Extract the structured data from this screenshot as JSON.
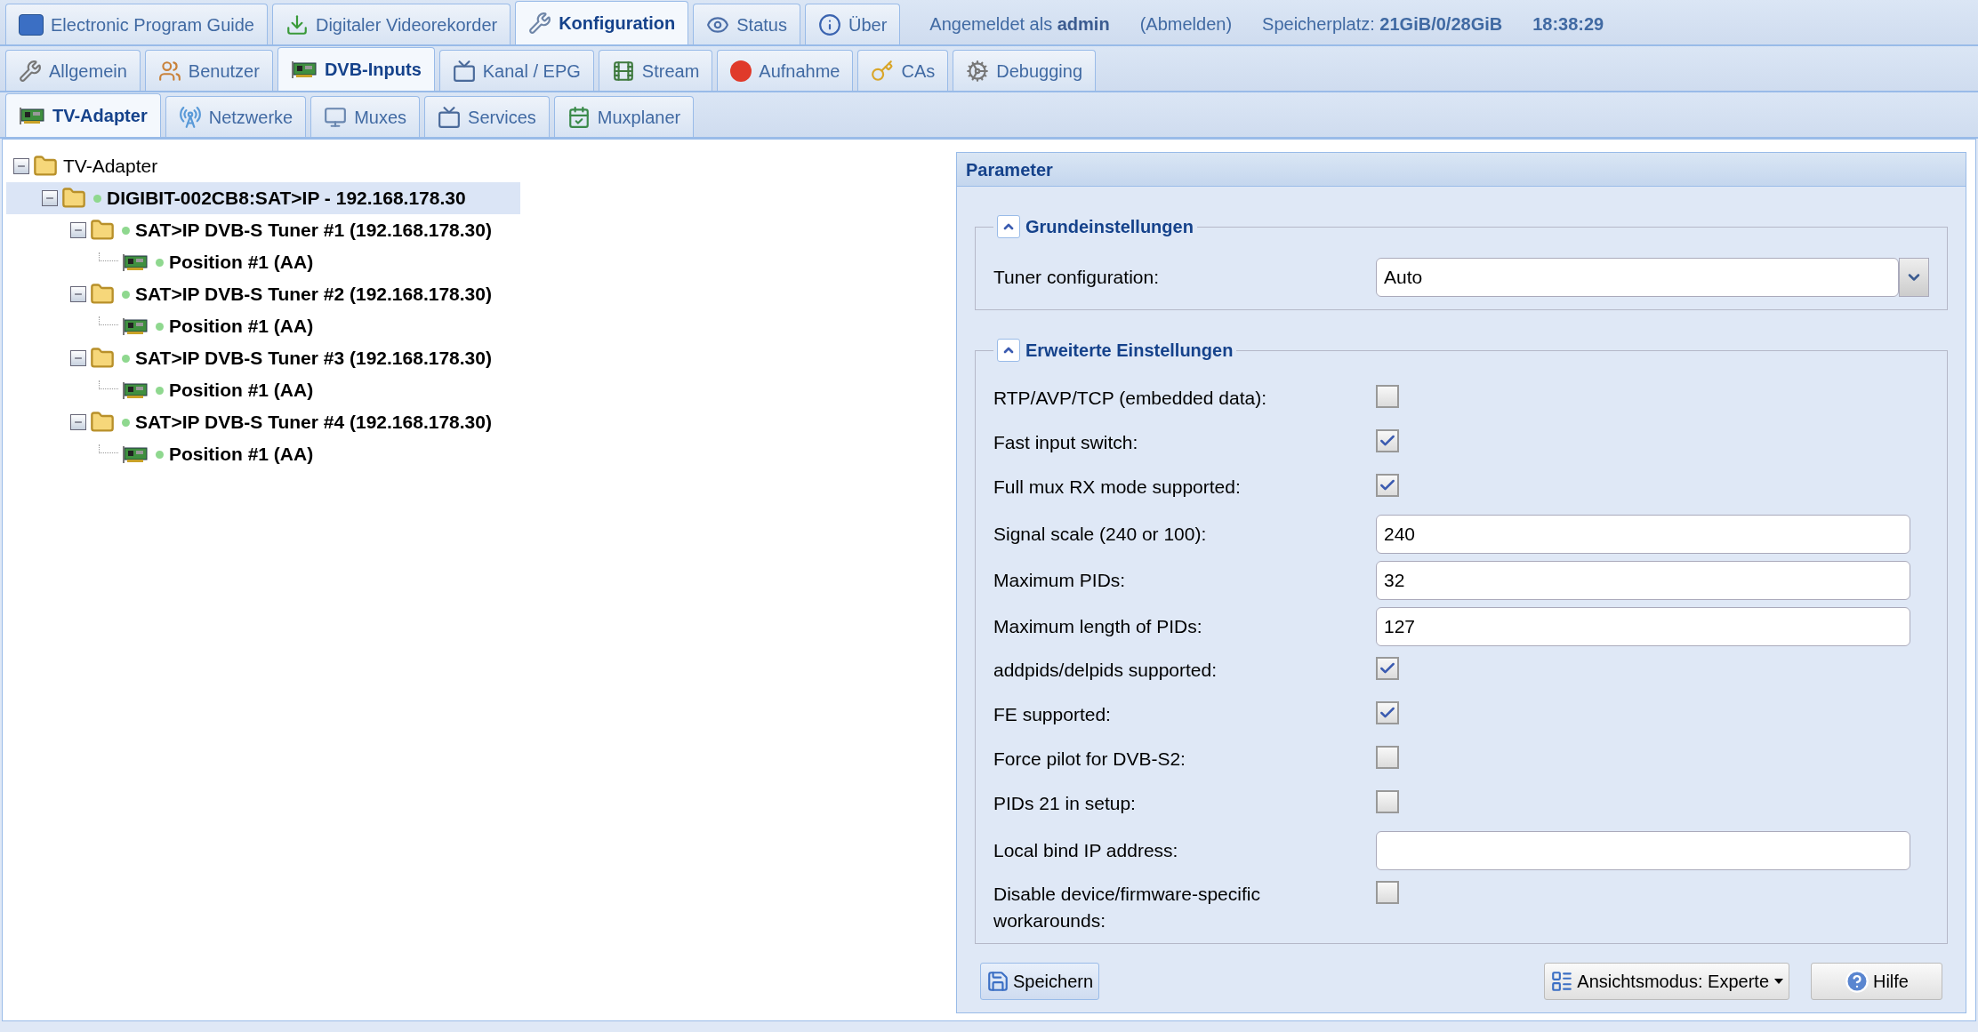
{
  "main_tabs": [
    {
      "label": "Electronic Program Guide",
      "selected": false
    },
    {
      "label": "Digitaler Videorekorder",
      "selected": false
    },
    {
      "label": "Konfiguration",
      "selected": true
    },
    {
      "label": "Status",
      "selected": false
    },
    {
      "label": "Über",
      "selected": false
    }
  ],
  "header": {
    "login": "Angemeldet als **admin**",
    "logout": "(Abmelden)",
    "storage": "Speicherplatz: **21GiB/0/28GiB**",
    "time": "18:38:29"
  },
  "config_tabs": [
    {
      "label": "Allgemein",
      "selected": false
    },
    {
      "label": "Benutzer",
      "selected": false
    },
    {
      "label": "DVB-Inputs",
      "selected": true
    },
    {
      "label": "Kanal / EPG",
      "selected": false
    },
    {
      "label": "Stream",
      "selected": false
    },
    {
      "label": "Aufnahme",
      "selected": false
    },
    {
      "label": "CAs",
      "selected": false
    },
    {
      "label": "Debugging",
      "selected": false
    }
  ],
  "dvb_tabs": [
    {
      "label": "TV-Adapter",
      "selected": true
    },
    {
      "label": "Netzwerke",
      "selected": false
    },
    {
      "label": "Muxes",
      "selected": false
    },
    {
      "label": "Services",
      "selected": false
    },
    {
      "label": "Muxplaner",
      "selected": false
    }
  ],
  "tree": [
    {
      "label": "TV-Adapter",
      "kind": "root",
      "expanded": true,
      "selected": false,
      "children": [
        {
          "label": "DIGIBIT-002CB8:SAT>IP - 192.168.178.30",
          "kind": "folder",
          "expanded": true,
          "selected": true,
          "children": [
            {
              "label": "SAT>IP DVB-S Tuner #1 (192.168.178.30)",
              "kind": "folder",
              "expanded": true,
              "selected": false,
              "children": [
                {
                  "label": "Position #1 (AA)",
                  "kind": "adapter",
                  "selected": false
                }
              ]
            },
            {
              "label": "SAT>IP DVB-S Tuner #2 (192.168.178.30)",
              "kind": "folder",
              "expanded": true,
              "selected": false,
              "children": [
                {
                  "label": "Position #1 (AA)",
                  "kind": "adapter",
                  "selected": false
                }
              ]
            },
            {
              "label": "SAT>IP DVB-S Tuner #3 (192.168.178.30)",
              "kind": "folder",
              "expanded": true,
              "selected": false,
              "children": [
                {
                  "label": "Position #1 (AA)",
                  "kind": "adapter",
                  "selected": false
                }
              ]
            },
            {
              "label": "SAT>IP DVB-S Tuner #4 (192.168.178.30)",
              "kind": "folder",
              "expanded": true,
              "selected": false,
              "children": [
                {
                  "label": "Position #1 (AA)",
                  "kind": "adapter",
                  "selected": false
                }
              ]
            }
          ]
        }
      ]
    }
  ],
  "parameter_panel": {
    "title": "Parameter",
    "sections": [
      {
        "title": "Grundeinstellungen",
        "expanded": true,
        "fields": [
          {
            "kind": "select",
            "label": "Tuner configuration:",
            "value": "Auto"
          }
        ]
      },
      {
        "title": "Erweiterte Einstellungen",
        "expanded": true,
        "fields": [
          {
            "kind": "checkbox",
            "label": "RTP/AVP/TCP (embedded data):",
            "checked": false
          },
          {
            "kind": "checkbox",
            "label": "Fast input switch:",
            "checked": true
          },
          {
            "kind": "checkbox",
            "label": "Full mux RX mode supported:",
            "checked": true
          },
          {
            "kind": "text",
            "label": "Signal scale (240 or 100):",
            "value": "240"
          },
          {
            "kind": "text",
            "label": "Maximum PIDs:",
            "value": "32"
          },
          {
            "kind": "text",
            "label": "Maximum length of PIDs:",
            "value": "127"
          },
          {
            "kind": "checkbox",
            "label": "addpids/delpids supported:",
            "checked": true
          },
          {
            "kind": "checkbox",
            "label": "FE supported:",
            "checked": true
          },
          {
            "kind": "checkbox",
            "label": "Force pilot for DVB-S2:",
            "checked": false
          },
          {
            "kind": "checkbox",
            "label": "PIDs 21 in setup:",
            "checked": false
          },
          {
            "kind": "text",
            "label": "Local bind IP address:"
          },
          {
            "kind": "checkbox",
            "label": "Disable device/firmware-specific workarounds:",
            "checked": false
          }
        ]
      }
    ],
    "buttons": [
      {
        "label": "Speichern",
        "kind": "save"
      },
      {
        "label": "Ansichtsmodus: Experte",
        "kind": "view"
      },
      {
        "label": "Hilfe",
        "kind": "help"
      }
    ]
  }
}
